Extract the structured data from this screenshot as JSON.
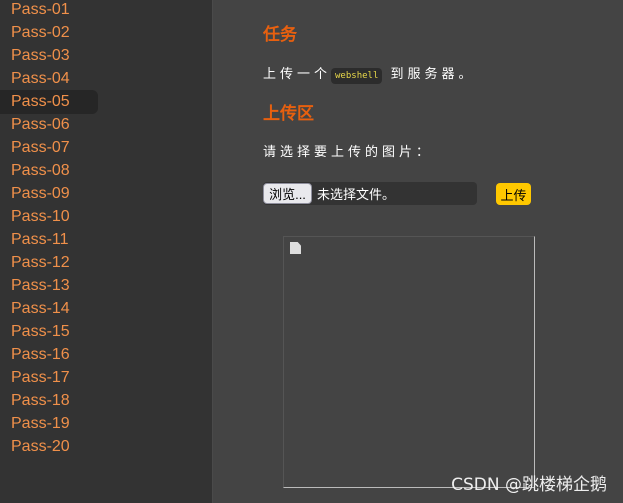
{
  "sidebar": {
    "items": [
      "Pass-01",
      "Pass-02",
      "Pass-03",
      "Pass-04",
      "Pass-05",
      "Pass-06",
      "Pass-07",
      "Pass-08",
      "Pass-09",
      "Pass-10",
      "Pass-11",
      "Pass-12",
      "Pass-13",
      "Pass-14",
      "Pass-15",
      "Pass-16",
      "Pass-17",
      "Pass-18",
      "Pass-19",
      "Pass-20"
    ],
    "active_index": 4
  },
  "task": {
    "title": "任务",
    "text_before": "上传一个",
    "code": "webshell",
    "text_after": "到服务器。"
  },
  "upload": {
    "title": "上传区",
    "prompt": "请选择要上传的图片：",
    "browse_label": "浏览...",
    "no_file": "未选择文件。",
    "submit_label": "上传"
  },
  "watermark": "CSDN @跳楼梯企鹅"
}
